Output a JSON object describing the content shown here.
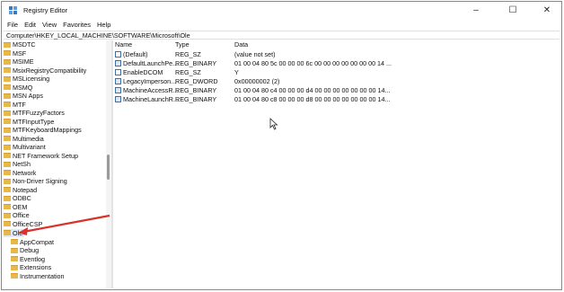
{
  "window": {
    "title": "Registry Editor",
    "controls": [
      "–",
      "☐",
      "✕"
    ]
  },
  "menu": [
    "File",
    "Edit",
    "View",
    "Favorites",
    "Help"
  ],
  "address": "Computer\\HKEY_LOCAL_MACHINE\\SOFTWARE\\Microsoft\\Ole",
  "tree": {
    "items": [
      "MSDTC",
      "MSF",
      "MSIME",
      "MsixRegistryCompatibility",
      "MSLicensing",
      "MSMQ",
      "MSN Apps",
      "MTF",
      "MTFFuzzyFactors",
      "MTFInputType",
      "MTFKeyboardMappings",
      "Multimedia",
      "Multivariant",
      "NET Framework Setup",
      "NetSh",
      "Network",
      "Non-Driver Signing",
      "Notepad",
      "ODBC",
      "OEM",
      "Office",
      "OfficeCSP",
      "Ole"
    ],
    "children": [
      "AppCompat",
      "Debug",
      "Eventlog",
      "Extensions",
      "Instrumentation"
    ]
  },
  "columns": [
    "Name",
    "Type",
    "Data"
  ],
  "values": [
    {
      "name": "(Default)",
      "type": "REG_SZ",
      "data": "(value not set)",
      "kind": "sz"
    },
    {
      "name": "DefaultLaunchPe...",
      "type": "REG_BINARY",
      "data": "01 00 04 80 5c 00 00 00 6c 00 00 00 00 00 00 00 14 ...",
      "kind": "bin"
    },
    {
      "name": "EnableDCOM",
      "type": "REG_SZ",
      "data": "Y",
      "kind": "sz"
    },
    {
      "name": "LegacyImperson...",
      "type": "REG_DWORD",
      "data": "0x00000002 (2)",
      "kind": "bin"
    },
    {
      "name": "MachineAccessR...",
      "type": "REG_BINARY",
      "data": "01 00 04 80 c4 00 00 00 d4 00 00 00 00 00 00 00 14...",
      "kind": "bin"
    },
    {
      "name": "MachineLaunchR...",
      "type": "REG_BINARY",
      "data": "01 00 04 80 c8 00 00 00 d8 00 00 00 00 00 00 00 14...",
      "kind": "bin"
    }
  ],
  "colors": {
    "annotation_arrow": "#d9312b",
    "folder": "#e8b84a",
    "selection": "#dde8f8"
  }
}
